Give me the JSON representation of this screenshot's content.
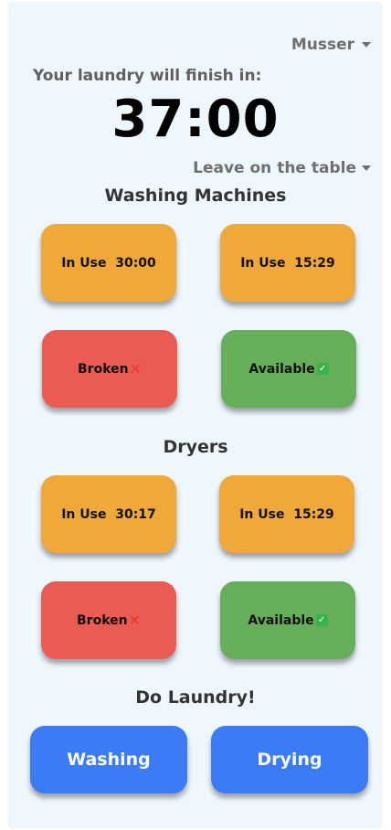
{
  "header": {
    "user": "Musser",
    "finish_label": "Your laundry will finish in:",
    "timer": "37:00",
    "notify_option": "Leave on the table"
  },
  "washing": {
    "title": "Washing Machines",
    "machines": [
      {
        "status": "In Use  30:00"
      },
      {
        "status": "In Use  15:29"
      },
      {
        "status": "Broken"
      },
      {
        "status": "Available"
      }
    ]
  },
  "dryers": {
    "title": "Dryers",
    "machines": [
      {
        "status": "In Use  30:17"
      },
      {
        "status": "In Use  15:29"
      },
      {
        "status": "Broken"
      },
      {
        "status": "Available"
      }
    ]
  },
  "actions": {
    "title": "Do Laundry!",
    "washing_label": "Washing",
    "drying_label": "Drying"
  },
  "icons": {
    "broken": "cross-mark-icon",
    "available": "check-mark-icon",
    "dropdown": "chevron-down-icon"
  },
  "colors": {
    "in_use": "#f0a83a",
    "broken": "#ec5b53",
    "available": "#67ae5b",
    "action": "#3b7bf5",
    "background": "#eef6fe"
  }
}
